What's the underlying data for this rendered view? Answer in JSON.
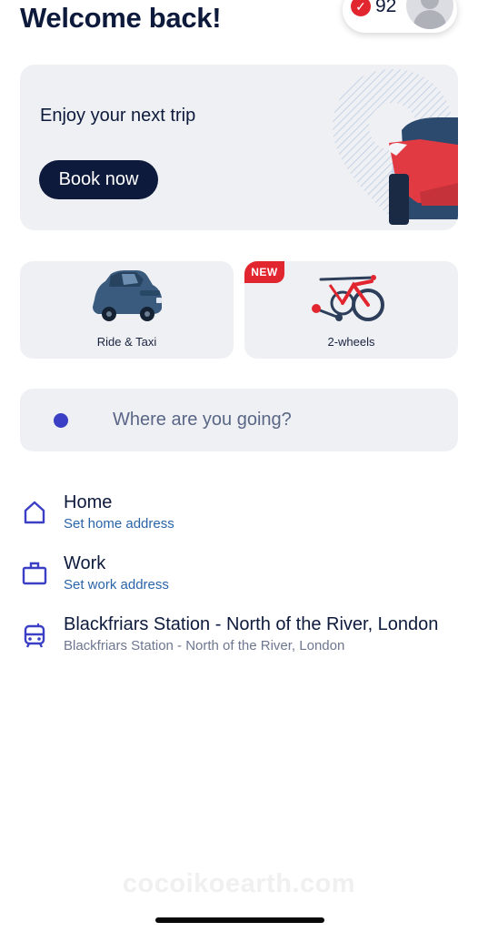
{
  "header": {
    "title": "Welcome back!",
    "points": "92",
    "points_badge_icon": "check-icon"
  },
  "promo": {
    "headline": "Enjoy your next trip",
    "button_label": "Book now"
  },
  "modes": [
    {
      "label": "Ride & Taxi",
      "icon": "taxi-icon"
    },
    {
      "label": "2-wheels",
      "badge": "NEW",
      "icon": "bike-scooter-icon"
    }
  ],
  "search": {
    "placeholder": "Where are you going?"
  },
  "places": [
    {
      "title": "Home",
      "subtitle": "Set home address",
      "icon": "home-icon"
    },
    {
      "title": "Work",
      "subtitle": "Set work address",
      "icon": "briefcase-icon"
    },
    {
      "title": "Blackfriars Station - North of the River, London",
      "subtitle": "Blackfriars Station - North of the River, London",
      "icon": "train-icon"
    }
  ],
  "watermark": "cocoikoearth.com",
  "colors": {
    "navy": "#0d1a3c",
    "accent_red": "#e2262f",
    "indigo": "#3a3fc5",
    "link_blue": "#2a64a8",
    "card_bg": "#eef0f3"
  }
}
